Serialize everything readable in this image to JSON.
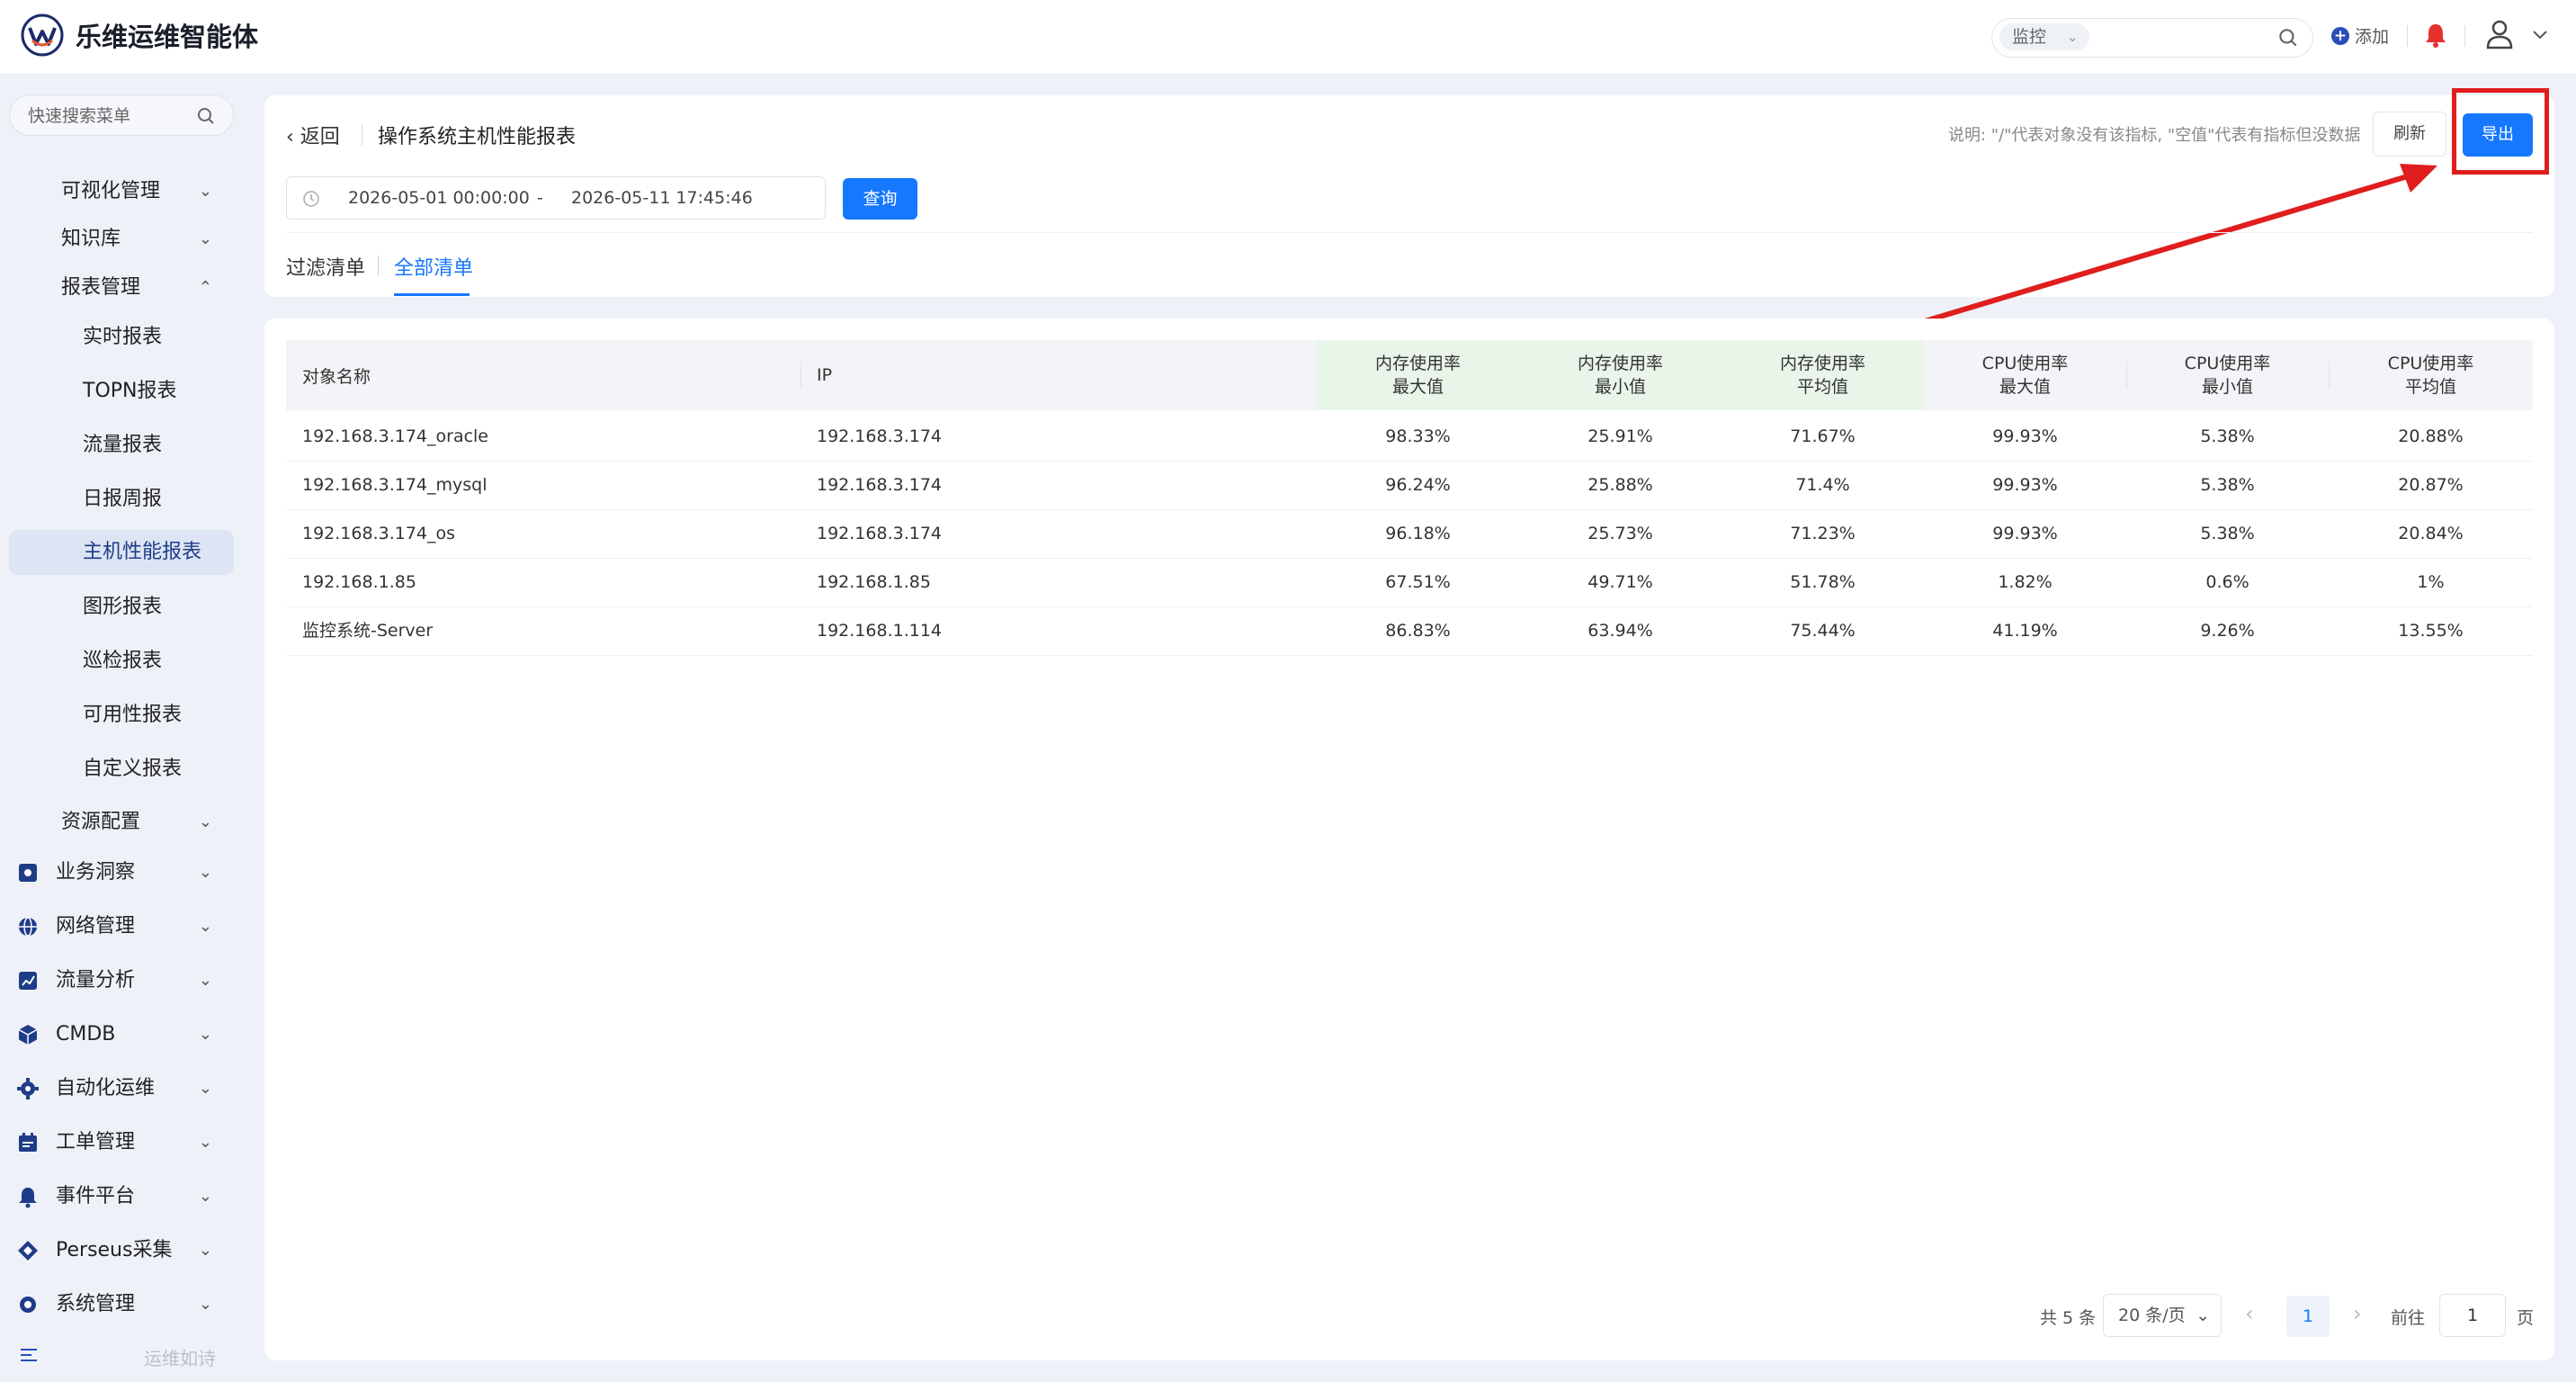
{
  "app": {
    "title": "乐维运维智能体"
  },
  "topbar": {
    "search_scope": "监控",
    "add_label": "添加"
  },
  "sidebar": {
    "search_placeholder": "快速搜索菜单",
    "items": [
      {
        "label": "可视化管理"
      },
      {
        "label": "知识库"
      },
      {
        "label": "报表管理"
      },
      {
        "label": "实时报表"
      },
      {
        "label": "TOPN报表"
      },
      {
        "label": "流量报表"
      },
      {
        "label": "日报周报"
      },
      {
        "label": "主机性能报表"
      },
      {
        "label": "图形报表"
      },
      {
        "label": "巡检报表"
      },
      {
        "label": "可用性报表"
      },
      {
        "label": "自定义报表"
      },
      {
        "label": "资源配置"
      },
      {
        "label": "业务洞察"
      },
      {
        "label": "网络管理"
      },
      {
        "label": "流量分析"
      },
      {
        "label": "CMDB"
      },
      {
        "label": "自动化运维"
      },
      {
        "label": "工单管理"
      },
      {
        "label": "事件平台"
      },
      {
        "label": "Perseus采集"
      },
      {
        "label": "系统管理"
      }
    ],
    "footer_slogan": "运维如诗"
  },
  "header": {
    "back_label": "返回",
    "title": "操作系统主机性能报表",
    "note": "说明: \"/\"代表对象没有该指标, \"空值\"代表有指标但没数据",
    "refresh_label": "刷新",
    "export_label": "导出",
    "date_start": "2026-05-01 00:00:00",
    "date_sep": "-",
    "date_end": "2026-05-11 17:45:46",
    "query_label": "查询",
    "tabs": [
      {
        "label": "过滤清单"
      },
      {
        "label": "全部清单"
      }
    ]
  },
  "table": {
    "columns": [
      {
        "l1": "对象名称",
        "l2": ""
      },
      {
        "l1": "IP",
        "l2": ""
      },
      {
        "l1": "内存使用率",
        "l2": "最大值"
      },
      {
        "l1": "内存使用率",
        "l2": "最小值"
      },
      {
        "l1": "内存使用率",
        "l2": "平均值"
      },
      {
        "l1": "CPU使用率",
        "l2": "最大值"
      },
      {
        "l1": "CPU使用率",
        "l2": "最小值"
      },
      {
        "l1": "CPU使用率",
        "l2": "平均值"
      }
    ],
    "rows": [
      [
        "192.168.3.174_oracle",
        "192.168.3.174",
        "98.33%",
        "25.91%",
        "71.67%",
        "99.93%",
        "5.38%",
        "20.88%"
      ],
      [
        "192.168.3.174_mysql",
        "192.168.3.174",
        "96.24%",
        "25.88%",
        "71.4%",
        "99.93%",
        "5.38%",
        "20.87%"
      ],
      [
        "192.168.3.174_os",
        "192.168.3.174",
        "96.18%",
        "25.73%",
        "71.23%",
        "99.93%",
        "5.38%",
        "20.84%"
      ],
      [
        "192.168.1.85",
        "192.168.1.85",
        "67.51%",
        "49.71%",
        "51.78%",
        "1.82%",
        "0.6%",
        "1%"
      ],
      [
        "监控系统-Server",
        "192.168.1.114",
        "86.83%",
        "63.94%",
        "75.44%",
        "41.19%",
        "9.26%",
        "13.55%"
      ]
    ]
  },
  "pagination": {
    "total": "共 5 条",
    "page_size": "20 条/页",
    "current": "1",
    "goto_label": "前往",
    "goto_value": "1",
    "unit": "页"
  },
  "colors": {
    "accent": "#1677ff",
    "highlight": "#e01e1e",
    "alert": "#e5322d"
  }
}
